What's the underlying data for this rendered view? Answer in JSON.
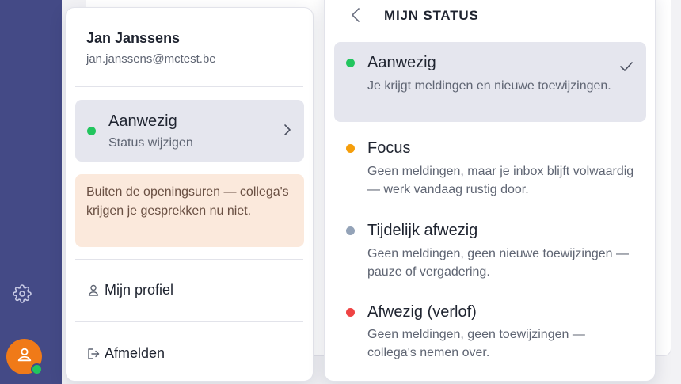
{
  "user": {
    "name": "Jan Janssens",
    "email": "jan.janssens@mctest.be"
  },
  "current_status": {
    "label": "Aanwezig",
    "action": "Status wijzigen",
    "color": "#22c55e"
  },
  "notice": {
    "text": "Buiten de openingsuren — collega's krijgen je gesprekken nu niet."
  },
  "menu": {
    "profile": "Mijn profiel",
    "logout": "Afmelden"
  },
  "status_panel": {
    "title": "MIJN STATUS",
    "options": [
      {
        "label": "Aanwezig",
        "description": "Je krijgt meldingen en nieuwe toewijzingen.",
        "color": "#22c55e",
        "selected": true
      },
      {
        "label": "Focus",
        "description": "Geen meldingen, maar je inbox blijft volwaardig — werk vandaag rustig door.",
        "color": "#f59e0b",
        "selected": false
      },
      {
        "label": "Tijdelijk afwezig",
        "description": "Geen meldingen, geen nieuwe toewijzingen — pauze of vergadering.",
        "color": "#94a3b8",
        "selected": false
      },
      {
        "label": "Afwezig (verlof)",
        "description": "Geen meldingen, geen toewijzingen — collega's nemen over.",
        "color": "#ef4444",
        "selected": false
      }
    ]
  },
  "sidebar": {
    "settings_icon": "gear-icon",
    "avatar_icon": "user-icon",
    "presence_color": "#22c55e"
  }
}
